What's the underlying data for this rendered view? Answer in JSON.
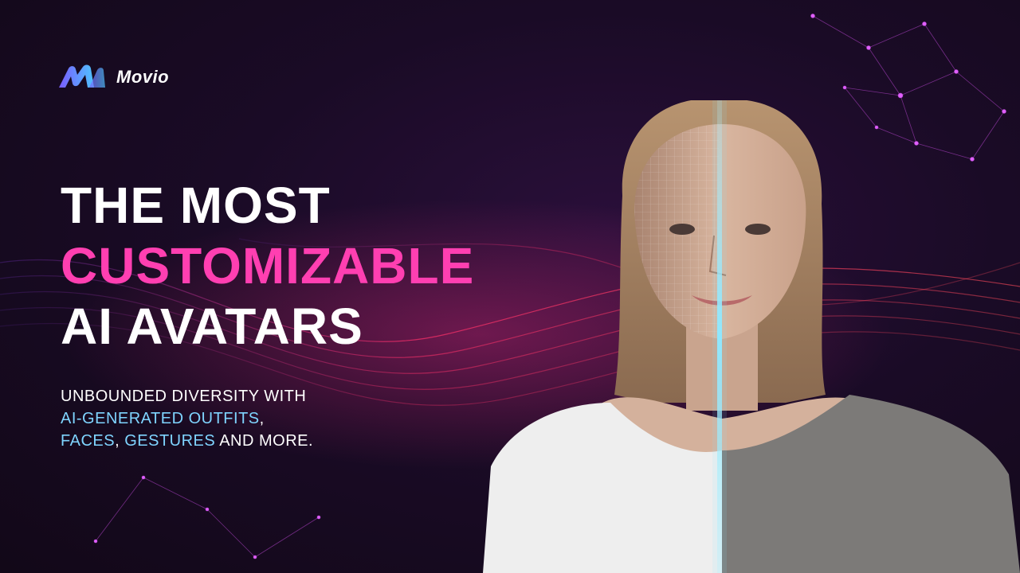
{
  "brand": {
    "name": "Movio"
  },
  "headline": {
    "line1": "THE MOST",
    "line2": "CUSTOMIZABLE",
    "line3": "AI AVATARS"
  },
  "subtext": {
    "line1": "UNBOUNDED DIVERSITY WITH",
    "line2_highlight": "AI-GENERATED OUTFITS",
    "line2_tail": ",",
    "line3_highlight1": "FACES",
    "line3_sep": ", ",
    "line3_highlight2": "GESTURES",
    "line3_tail": " AND MORE."
  },
  "colors": {
    "background": "#1a0b26",
    "headline_white": "#ffffff",
    "headline_accent": "#ff3fb1",
    "subtext_accent": "#7fd4ff",
    "logo_gradient_start": "#7a5cff",
    "logo_gradient_end": "#4fc3ff"
  },
  "icons": {
    "logo": "movio-logo-icon"
  }
}
